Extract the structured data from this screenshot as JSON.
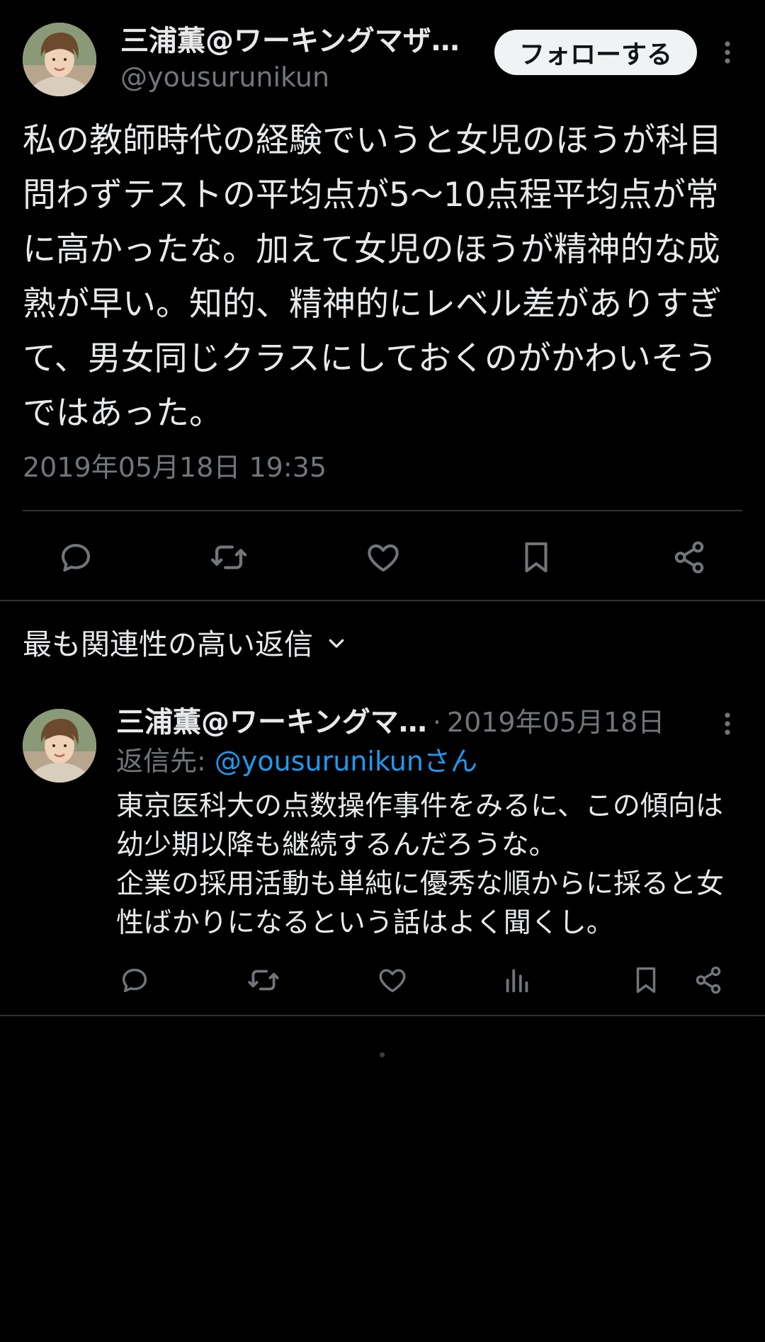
{
  "main_tweet": {
    "author_name": "三浦薫@ワーキングマザ…",
    "author_handle": "@yousurunikun",
    "follow_label": "フォローする",
    "text": "私の教師時代の経験でいうと女児のほうが科目問わずテストの平均点が5〜10点程平均点が常に高かったな。加えて女児のほうが精神的な成熟が早い。知的、精神的にレベル差がありすぎて、男女同じクラスにしておくのがかわいそうではあった。",
    "timestamp": "2019年05月18日 19:35",
    "actions": [
      "reply-icon",
      "retweet-icon",
      "like-icon",
      "bookmark-icon",
      "share-icon"
    ]
  },
  "replies": {
    "sort_label": "最も関連性の高い返信",
    "sort_icon": "chevron-down-icon"
  },
  "reply": {
    "author_name": "三浦薫@ワーキングマ…",
    "separator": "·",
    "date": "2019年05月18日",
    "reply_to_prefix": "返信先: ",
    "reply_to_handle": "@yousurunikunさん",
    "text": "東京医科大の点数操作事件をみるに、この傾向は幼少期以降も継続するんだろうな。\n企業の採用活動も単純に優秀な順からに採ると女性ばかりになるという話はよく聞くし。",
    "actions": [
      "reply-icon",
      "retweet-icon",
      "like-icon",
      "views-icon",
      "bookmark-icon",
      "share-icon"
    ]
  },
  "colors": {
    "background": "#000000",
    "text_primary": "#e7e9ea",
    "text_secondary": "#71767b",
    "link": "#1d9bf0",
    "divider": "#2f3336",
    "follow_button_bg": "#eff3f4",
    "follow_button_text": "#0f1419"
  }
}
